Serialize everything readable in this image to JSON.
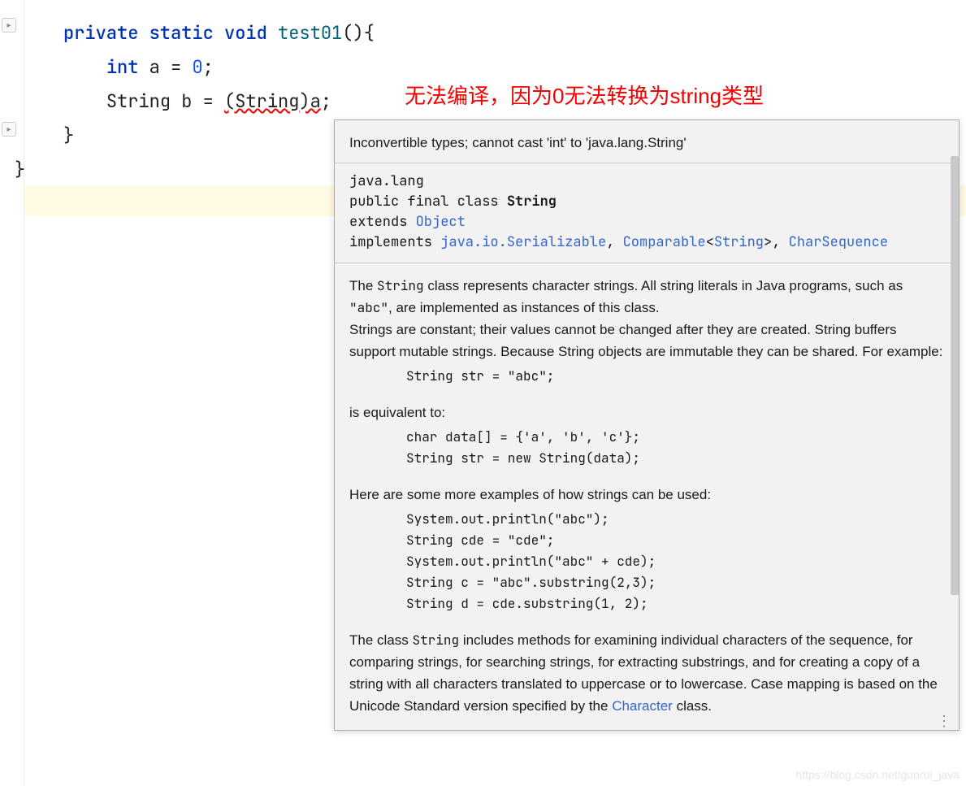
{
  "code": {
    "line1_kw1": "private",
    "line1_kw2": "static",
    "line1_kw3": "void",
    "line1_method": "test01",
    "line1_tail": "(){",
    "line2_kw": "int",
    "line2_rest": " a = ",
    "line2_num": "0",
    "line2_semi": ";",
    "line3_type": "String b = ",
    "line3_cast": "(String)a",
    "line3_tail": ";",
    "line4": "}",
    "line5": "}"
  },
  "red_note": "无法编译，因为0无法转换为string类型",
  "popup": {
    "error": "Inconvertible types; cannot cast 'int' to 'java.lang.String'",
    "decl_pkg": "java.lang",
    "decl_mod": "public final class ",
    "decl_class": "String",
    "decl_extends": "extends ",
    "decl_object": "Object",
    "decl_impl": "implements ",
    "decl_ser": "java.io.Serializable",
    "decl_comma": ", ",
    "decl_comp": "Comparable",
    "decl_lt": "<",
    "decl_stringlink": "String",
    "decl_gt": ">, ",
    "decl_charseq": "CharSequence",
    "body_p1a": "The ",
    "body_p1_code1": "String",
    "body_p1b": " class represents character strings. All string literals in Java programs, such as ",
    "body_p1_code2": "\"abc\"",
    "body_p1c": ", are implemented as instances of this class.",
    "body_p2": "Strings are constant; their values cannot be changed after they are created. String buffers support mutable strings. Because String objects are immutable they can be shared. For example:",
    "body_code1": "String str = \"abc\";",
    "body_eq": "is equivalent to:",
    "body_code2": "char data[] = {'a', 'b', 'c'};\nString str = new String(data);",
    "body_more": "Here are some more examples of how strings can be used:",
    "body_code3": "System.out.println(\"abc\");\nString cde = \"cde\";\nSystem.out.println(\"abc\" + cde);\nString c = \"abc\".substring(2,3);\nString d = cde.substring(1, 2);",
    "body_p3a": "The class ",
    "body_p3_code": "String",
    "body_p3b": " includes methods for examining individual characters of the sequence, for comparing strings, for searching strings, for extracting substrings, and for creating a copy of a string with all characters translated to uppercase or to lowercase. Case mapping is based on the Unicode Standard version specified by the ",
    "body_p3_link": "Character",
    "body_p3c": " class."
  },
  "dots": "⋮",
  "watermark": "https://blog.csdn.net/guorui_java"
}
